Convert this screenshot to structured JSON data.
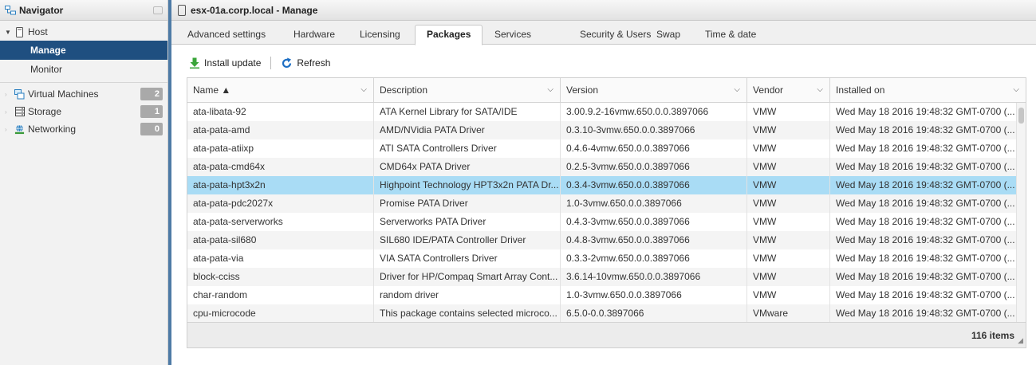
{
  "navigator": {
    "title": "Navigator",
    "host_label": "Host",
    "host_children": [
      {
        "label": "Manage",
        "active": true
      },
      {
        "label": "Monitor",
        "active": false
      }
    ],
    "items": [
      {
        "label": "Virtual Machines",
        "count": "2",
        "icon": "vm-icon"
      },
      {
        "label": "Storage",
        "count": "1",
        "icon": "storage-icon"
      },
      {
        "label": "Networking",
        "count": "0",
        "icon": "network-icon"
      }
    ]
  },
  "main": {
    "title": "esx-01a.corp.local - Manage",
    "tabs": [
      {
        "label": "Advanced settings"
      },
      {
        "label": "Hardware"
      },
      {
        "label": "Licensing"
      },
      {
        "label": "Packages",
        "active": true
      },
      {
        "label": "Services"
      },
      {
        "label": "Security & Users"
      },
      {
        "label": "Swap"
      },
      {
        "label": "Time & date"
      }
    ],
    "toolbar": {
      "install_label": "Install update",
      "refresh_label": "Refresh"
    },
    "grid": {
      "columns": [
        {
          "label": "Name ▲"
        },
        {
          "label": "Description"
        },
        {
          "label": "Version"
        },
        {
          "label": "Vendor"
        },
        {
          "label": "Installed on"
        }
      ],
      "rows": [
        {
          "name": "ata-libata-92",
          "description": "ATA Kernel Library for SATA/IDE",
          "version": "3.00.9.2-16vmw.650.0.0.3897066",
          "vendor": "VMW",
          "installed": "Wed May 18 2016 19:48:32 GMT-0700 (..."
        },
        {
          "name": "ata-pata-amd",
          "description": "AMD/NVidia PATA Driver",
          "version": "0.3.10-3vmw.650.0.0.3897066",
          "vendor": "VMW",
          "installed": "Wed May 18 2016 19:48:32 GMT-0700 (..."
        },
        {
          "name": "ata-pata-atiixp",
          "description": "ATI SATA Controllers Driver",
          "version": "0.4.6-4vmw.650.0.0.3897066",
          "vendor": "VMW",
          "installed": "Wed May 18 2016 19:48:32 GMT-0700 (..."
        },
        {
          "name": "ata-pata-cmd64x",
          "description": "CMD64x PATA Driver",
          "version": "0.2.5-3vmw.650.0.0.3897066",
          "vendor": "VMW",
          "installed": "Wed May 18 2016 19:48:32 GMT-0700 (..."
        },
        {
          "name": "ata-pata-hpt3x2n",
          "description": "Highpoint Technology HPT3x2n PATA Dr...",
          "version": "0.3.4-3vmw.650.0.0.3897066",
          "vendor": "VMW",
          "installed": "Wed May 18 2016 19:48:32 GMT-0700 (...",
          "selected": true
        },
        {
          "name": "ata-pata-pdc2027x",
          "description": "Promise PATA Driver",
          "version": "1.0-3vmw.650.0.0.3897066",
          "vendor": "VMW",
          "installed": "Wed May 18 2016 19:48:32 GMT-0700 (..."
        },
        {
          "name": "ata-pata-serverworks",
          "description": "Serverworks PATA Driver",
          "version": "0.4.3-3vmw.650.0.0.3897066",
          "vendor": "VMW",
          "installed": "Wed May 18 2016 19:48:32 GMT-0700 (..."
        },
        {
          "name": "ata-pata-sil680",
          "description": "SIL680 IDE/PATA Controller Driver",
          "version": "0.4.8-3vmw.650.0.0.3897066",
          "vendor": "VMW",
          "installed": "Wed May 18 2016 19:48:32 GMT-0700 (..."
        },
        {
          "name": "ata-pata-via",
          "description": "VIA SATA Controllers Driver",
          "version": "0.3.3-2vmw.650.0.0.3897066",
          "vendor": "VMW",
          "installed": "Wed May 18 2016 19:48:32 GMT-0700 (..."
        },
        {
          "name": "block-cciss",
          "description": "Driver for HP/Compaq Smart Array Cont...",
          "version": "3.6.14-10vmw.650.0.0.3897066",
          "vendor": "VMW",
          "installed": "Wed May 18 2016 19:48:32 GMT-0700 (..."
        },
        {
          "name": "char-random",
          "description": "random driver",
          "version": "1.0-3vmw.650.0.0.3897066",
          "vendor": "VMW",
          "installed": "Wed May 18 2016 19:48:32 GMT-0700 (..."
        },
        {
          "name": "cpu-microcode",
          "description": "This package contains selected microco...",
          "version": "6.5.0-0.0.3897066",
          "vendor": "VMware",
          "installed": "Wed May 18 2016 19:48:32 GMT-0700 (..."
        }
      ],
      "footer_count": "116 items"
    }
  },
  "colors": {
    "active_nav": "#1f4f80",
    "selected_row": "#a9dcf5",
    "splitter": "#4e7ba6",
    "badge": "#a9a9a9"
  }
}
